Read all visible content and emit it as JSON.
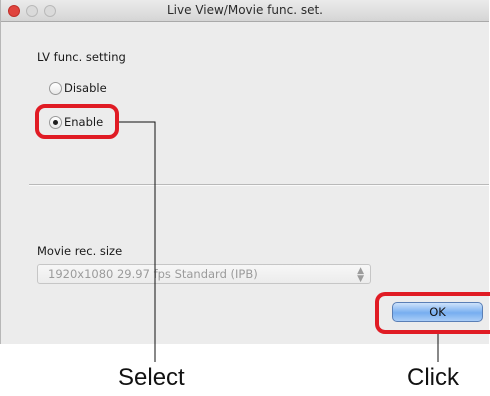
{
  "window": {
    "title": "Live View/Movie func. set."
  },
  "lv_setting": {
    "heading": "LV func. setting",
    "options": [
      {
        "label": "Disable",
        "selected": false
      },
      {
        "label": "Enable",
        "selected": true
      }
    ]
  },
  "movie": {
    "heading": "Movie rec. size",
    "select_value": "1920x1080 29.97 fps  Standard (IPB)",
    "select_enabled": false
  },
  "ok_button": {
    "label": "OK"
  },
  "annotations": {
    "select_label": "Select",
    "click_label": "Click",
    "highlight_color": "#e01b24"
  },
  "icons": {
    "close": "close-icon",
    "minimize": "minimize-icon",
    "zoom": "zoom-icon",
    "select_arrows": "chevron-up-down-icon"
  }
}
